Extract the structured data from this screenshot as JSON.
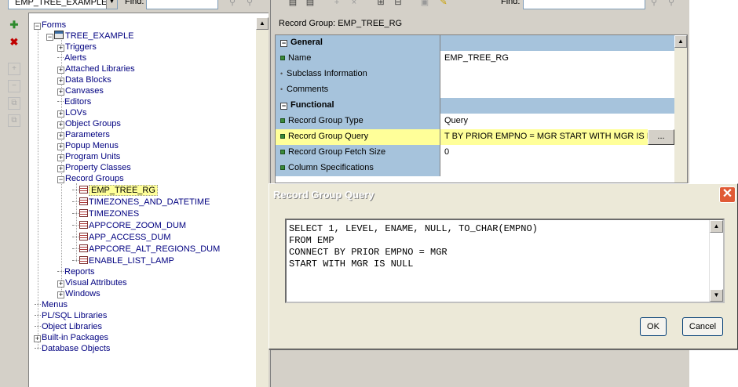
{
  "navigator": {
    "combo_value": "EMP_TREE_EXAMPLE",
    "find_label": "Find:",
    "tree": {
      "root": "Forms",
      "module": "TREE_EXAMPLE",
      "module_children": [
        "Triggers",
        "Alerts",
        "Attached Libraries",
        "Data Blocks",
        "Canvases",
        "Editors",
        "LOVs",
        "Object Groups",
        "Parameters",
        "Popup Menus",
        "Program Units",
        "Property Classes",
        "Record Groups"
      ],
      "record_groups": [
        "EMP_TREE_RG",
        "TIMEZONES_AND_DATETIME",
        "TIMEZONES",
        "APPCORE_ZOOM_DUM",
        "APP_ACCESS_DUM",
        "APPCORE_ALT_REGIONS_DUM",
        "ENABLE_LIST_LAMP"
      ],
      "after_groups": [
        "Reports",
        "Visual Attributes",
        "Windows"
      ],
      "top_level": [
        "Menus",
        "PL/SQL Libraries",
        "Object Libraries",
        "Built-in Packages",
        "Database Objects"
      ]
    }
  },
  "palette": {
    "find_label": "Find:",
    "title": "Record Group: EMP_TREE_RG",
    "rows": [
      {
        "label": "General",
        "value": "",
        "section": true
      },
      {
        "label": "Name",
        "value": "EMP_TREE_RG"
      },
      {
        "label": "Subclass Information",
        "value": ""
      },
      {
        "label": "Comments",
        "value": ""
      },
      {
        "label": "Functional",
        "value": "",
        "section": true
      },
      {
        "label": "Record Group Type",
        "value": "Query"
      },
      {
        "label": "Record Group Query",
        "value": "T BY PRIOR EMPNO = MGR START WITH MGR IS NULL"
      },
      {
        "label": "Record Group Fetch Size",
        "value": "0"
      },
      {
        "label": "Column Specifications",
        "value": ""
      }
    ],
    "ellipsis": "..."
  },
  "dialog": {
    "title": "Record Group Query",
    "close": "✕",
    "query": "SELECT 1, LEVEL, ENAME, NULL, TO_CHAR(EMPNO)\nFROM EMP\nCONNECT BY PRIOR EMPNO = MGR\nSTART WITH MGR IS NULL",
    "ok_label": "OK",
    "cancel_label": "Cancel"
  },
  "colors": {
    "grid_label_bg": "#a6c3dc",
    "highlight": "#ffff99",
    "tree_text": "#000080",
    "close_button": "#e05a35"
  }
}
